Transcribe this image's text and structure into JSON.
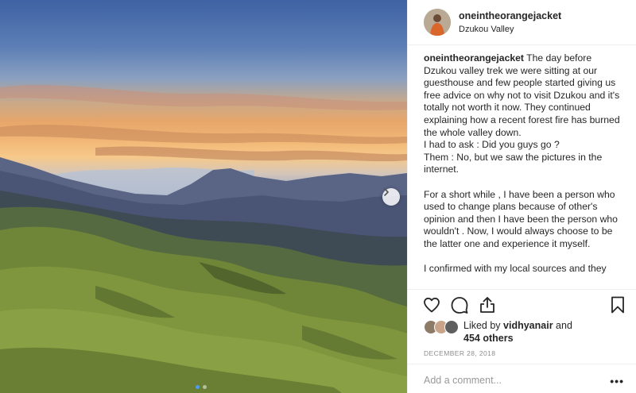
{
  "post": {
    "username": "oneintheorangejacket",
    "location": "Dzukou Valley",
    "caption": {
      "user": "oneintheorangejacket",
      "line1": " The day before Dzukou valley trek we were sitting at our guesthouse and few people started giving us free advice on why not to visit Dzukou and it's totally not worth it now. They continued explaining how a recent forest fire has burned the whole valley down.",
      "line2": "I had to ask : Did you guys go ?",
      "line3": "Them : No, but we saw the pictures in the internet.",
      "para2": "For a short while , I have been a person who used to change plans because of other's opinion and then I have been the person who wouldn't . Now, I would always choose to be the latter one and experience it myself.",
      "para3": "I confirmed with my local sources and they"
    },
    "likes": {
      "prefix": "Liked by ",
      "user": "vidhyanair",
      "and": " and",
      "others": "454 others"
    },
    "date": "DECEMBER 28, 2018",
    "comment_placeholder": "Add a comment...",
    "more": "•••"
  },
  "carousel": {
    "slide_count": 2,
    "active_index": 0
  },
  "icons": {
    "like": "heart-icon",
    "comment": "comment-bubble-icon",
    "share": "share-icon",
    "save": "bookmark-icon",
    "next": "chevron-right-icon",
    "more": "more-options-icon"
  },
  "colors": {
    "text": "#262626",
    "muted": "#8e8e8e",
    "divider": "#efefef",
    "active_dot": "#4a9eed"
  }
}
